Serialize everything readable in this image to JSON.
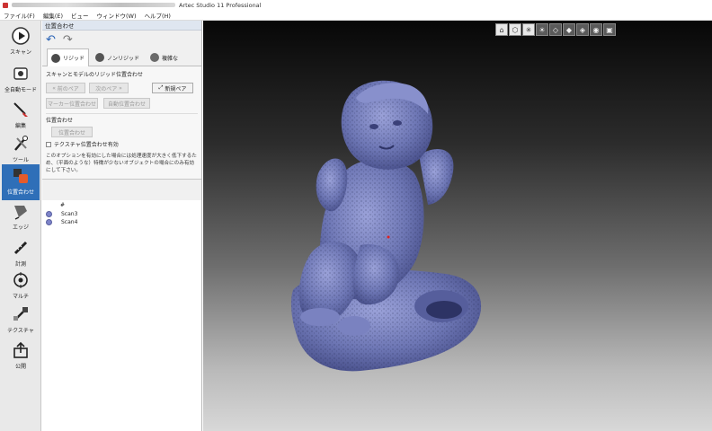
{
  "window": {
    "title": "Artec Studio 11 Professional"
  },
  "menu": [
    "ファイル(F)",
    "編集(E)",
    "ビュー",
    "ウィンドウ(W)",
    "ヘルプ(H)"
  ],
  "toolbar": {
    "items": [
      {
        "label": "スキャン",
        "icon": "play-icon"
      },
      {
        "label": "全自動モード",
        "icon": "auto-mode-icon"
      },
      {
        "label": "編集",
        "icon": "edit-knife-icon"
      },
      {
        "label": "ツール",
        "icon": "tools-icon"
      },
      {
        "label": "位置合わせ",
        "icon": "align-icon",
        "active": true
      },
      {
        "label": "エッジ",
        "icon": "edge-icon"
      },
      {
        "label": "計測",
        "icon": "measure-icon"
      },
      {
        "label": "マルチ",
        "icon": "multi-icon"
      },
      {
        "label": "テクスチャ",
        "icon": "texture-icon"
      },
      {
        "label": "公開",
        "icon": "publish-icon"
      }
    ]
  },
  "panel": {
    "header": "位置合わせ",
    "tabs": [
      {
        "label": "リジッド",
        "active": true,
        "color": "#4a4a4a"
      },
      {
        "label": "ノンリジッド",
        "active": false,
        "color": "#555"
      },
      {
        "label": "複雑な",
        "active": false,
        "color": "#6a6a6a"
      }
    ],
    "section_title": "スキャンとモデルのリジッド位置合わせ",
    "prev_pair": "前のペア",
    "next_pair": "次のペア",
    "new_pair": "新規ペア",
    "marker_align": "マーカー位置合わせ",
    "auto_align": "自動位置合わせ",
    "align_label": "位置合わせ",
    "align_button": "位置合わせ",
    "texture_checkbox": "テクスチャ位置合わせ有効",
    "note": "このオプションを有効にした場合には処理速度が大きく低下するため、（平面のような）特徴が少ないオブジェクトの場合にのみ有効にして下さい。",
    "list_header": "#",
    "scans": [
      "Scan3",
      "Scan4"
    ]
  },
  "viewport": {
    "view_buttons": [
      "home-view-icon",
      "cube-front-icon",
      "axes-icon",
      "light-icon",
      "wireframe-icon",
      "cube-solid-icon",
      "cube-texture-icon",
      "sphere-icon",
      "cube-box-icon"
    ],
    "model_color": "#6d76b4"
  }
}
